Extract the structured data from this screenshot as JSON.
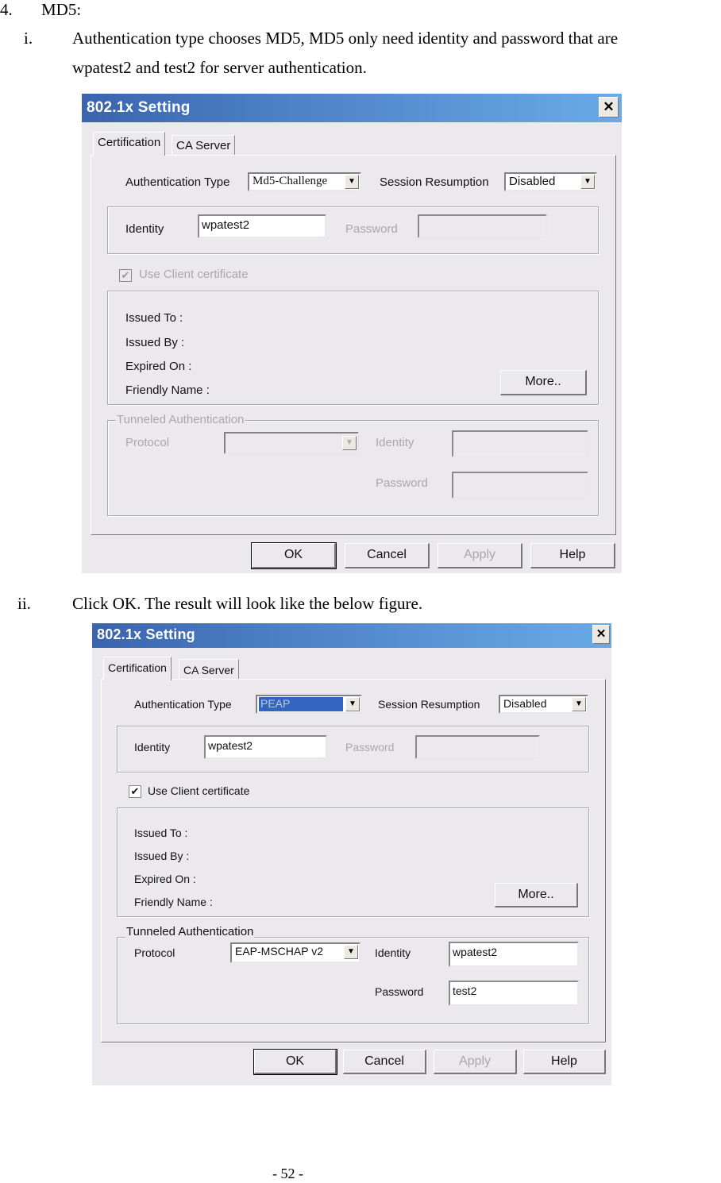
{
  "document": {
    "item_number": "4.",
    "item_title": "MD5:",
    "step_i_marker": "i.",
    "step_i_line1": "Authentication type chooses MD5, MD5 only need identity and password that are",
    "step_i_line2": "wpatest2 and test2 for server authentication.",
    "step_ii_marker": "ii.",
    "step_ii_text": "Click OK. The result will look like the below figure.",
    "page_number": "- 52 -"
  },
  "dialog1": {
    "title": "802.1x Setting",
    "close_icon": "close-icon",
    "tabs": [
      {
        "label": "Certification",
        "active": true
      },
      {
        "label": "CA Server",
        "active": false
      }
    ],
    "auth_type_label": "Authentication Type",
    "auth_type_value": "Md5-Challenge",
    "session_resumption_label": "Session Resumption",
    "session_resumption_value": "Disabled",
    "identity_label": "Identity",
    "identity_value": "wpatest2",
    "password_label": "Password",
    "password_value": "",
    "use_client_cert_label": "Use Client certificate",
    "use_client_cert_checked": true,
    "use_client_cert_enabled": false,
    "cert_info": [
      "Issued To :",
      "Issued By :",
      "Expired On :",
      "Friendly Name :"
    ],
    "more_button": "More..",
    "tunneled_legend": "Tunneled Authentication",
    "protocol_label": "Protocol",
    "protocol_value": "",
    "tunnel_identity_label": "Identity",
    "tunnel_identity_value": "",
    "tunnel_password_label": "Password",
    "tunnel_password_value": "",
    "buttons": {
      "ok": "OK",
      "cancel": "Cancel",
      "apply": "Apply",
      "help": "Help"
    }
  },
  "dialog2": {
    "title": "802.1x Setting",
    "close_icon": "close-icon",
    "tabs": [
      {
        "label": "Certification",
        "active": true
      },
      {
        "label": "CA Server",
        "active": false
      }
    ],
    "auth_type_label": "Authentication Type",
    "auth_type_value": "PEAP",
    "session_resumption_label": "Session Resumption",
    "session_resumption_value": "Disabled",
    "identity_label": "Identity",
    "identity_value": "wpatest2",
    "password_label": "Password",
    "password_value": "",
    "use_client_cert_label": "Use Client certificate",
    "use_client_cert_checked": true,
    "use_client_cert_enabled": true,
    "cert_info": [
      "Issued To :",
      "Issued By :",
      "Expired On :",
      "Friendly Name :"
    ],
    "more_button": "More..",
    "tunneled_legend": "Tunneled Authentication",
    "protocol_label": "Protocol",
    "protocol_value": "EAP-MSCHAP v2",
    "tunnel_identity_label": "Identity",
    "tunnel_identity_value": "wpatest2",
    "tunnel_password_label": "Password",
    "tunnel_password_value": "test2",
    "buttons": {
      "ok": "OK",
      "cancel": "Cancel",
      "apply": "Apply",
      "help": "Help"
    }
  },
  "colors": {
    "titlebar_start": "#3a64ad",
    "titlebar_end": "#6aaae8",
    "dialog_bg": "#ebe9ed",
    "selection": "#3264c0",
    "disabled_text": "#a8a8a8"
  }
}
